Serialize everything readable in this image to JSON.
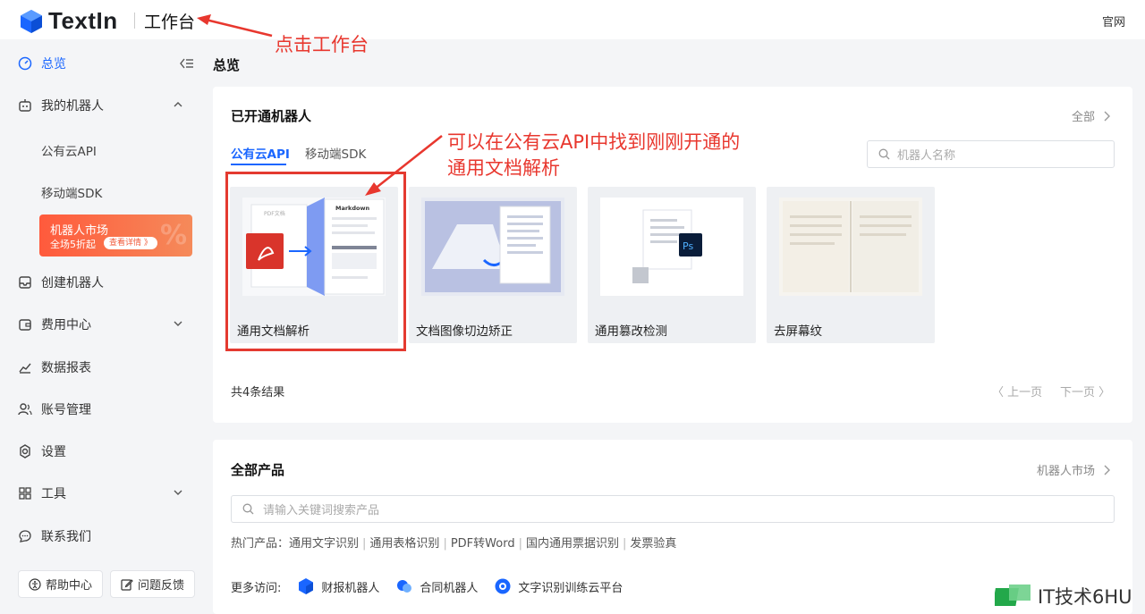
{
  "header": {
    "logo_text": "TextIn",
    "workbench": "工作台",
    "official": "官网"
  },
  "sidebar": {
    "overview": "总览",
    "my_robots": "我的机器人",
    "public_cloud_api": "公有云API",
    "mobile_sdk": "移动端SDK",
    "market_title": "机器人市场",
    "market_sub": "全场5折起",
    "market_pill": "查看详情 》",
    "market_pct": "%",
    "create_robot": "创建机器人",
    "billing": "费用中心",
    "reports": "数据报表",
    "account": "账号管理",
    "settings": "设置",
    "tools": "工具",
    "contact": "联系我们",
    "help": "帮助中心",
    "feedback": "问题反馈"
  },
  "main": {
    "page_title": "总览",
    "opened": {
      "title": "已开通机器人",
      "all_link": "全部",
      "tabs": [
        "公有云API",
        "移动端SDK"
      ],
      "search_placeholder": "机器人名称",
      "robots": [
        {
          "name": "通用文档解析",
          "thumb_label_a": "PDF文档",
          "thumb_label_b": "Markdown"
        },
        {
          "name": "文档图像切边矫正"
        },
        {
          "name": "通用篡改检测",
          "thumb_label_a": "Ps"
        },
        {
          "name": "去屏幕纹"
        }
      ],
      "result_count": "共4条结果",
      "prev": "〈 上一页",
      "next": "下一页 〉"
    },
    "products": {
      "title": "全部产品",
      "market_link": "机器人市场",
      "search_placeholder": "请输入关键词搜索产品",
      "hot_label": "热门产品：",
      "hot_items": [
        "通用文字识别",
        "通用表格识别",
        "PDF转Word",
        "国内通用票据识别",
        "发票验真"
      ],
      "more_label": "更多访问:",
      "more_items": [
        "财报机器人",
        "合同机器人",
        "文字识别训练云平台"
      ]
    }
  },
  "annotations": {
    "click_workbench": "点击工作台",
    "find_line1": "可以在公有云API中找到刚刚开通的",
    "find_line2": "通用文档解析"
  },
  "watermark": {
    "text": "IT技术6HU"
  },
  "colors": {
    "accent": "#1a66ff",
    "annotation": "#e8372e",
    "banner": "#ff5a3c"
  }
}
